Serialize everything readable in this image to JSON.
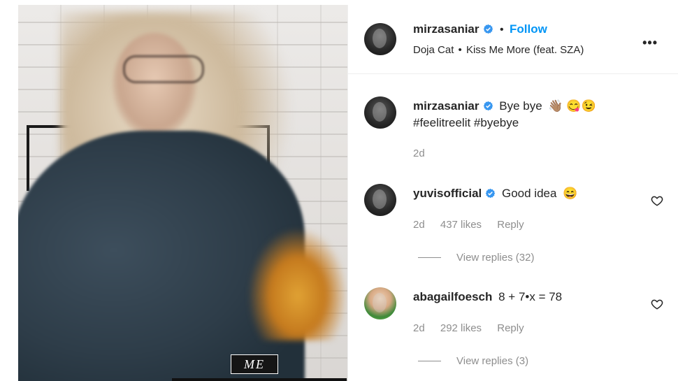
{
  "post": {
    "username": "mirzasaniar",
    "follow_label": "Follow",
    "separator": "•",
    "audio_artist": "Doja Cat",
    "audio_track": "Kiss Me More (feat. SZA)",
    "more_label": "•••",
    "media_caption": "ME"
  },
  "caption": {
    "username": "mirzasaniar",
    "text": "Bye bye",
    "emojis": "👋🏽 😋😉",
    "hashtags": "#feelitreelit #byebye",
    "time": "2d"
  },
  "comments": [
    {
      "username": "yuvisofficial",
      "text": "Good idea",
      "emoji": "😄",
      "time": "2d",
      "likes": "437 likes",
      "reply_label": "Reply",
      "view_replies": "View replies (32)"
    },
    {
      "username": "abagailfoesch",
      "text": "8 + 7•x = 78",
      "emoji": "",
      "time": "2d",
      "likes": "292 likes",
      "reply_label": "Reply",
      "view_replies": "View replies (3)"
    }
  ],
  "colors": {
    "follow": "#0095f6",
    "verified": "#3897f0",
    "muted": "#8e8e8e",
    "text": "#262626"
  }
}
